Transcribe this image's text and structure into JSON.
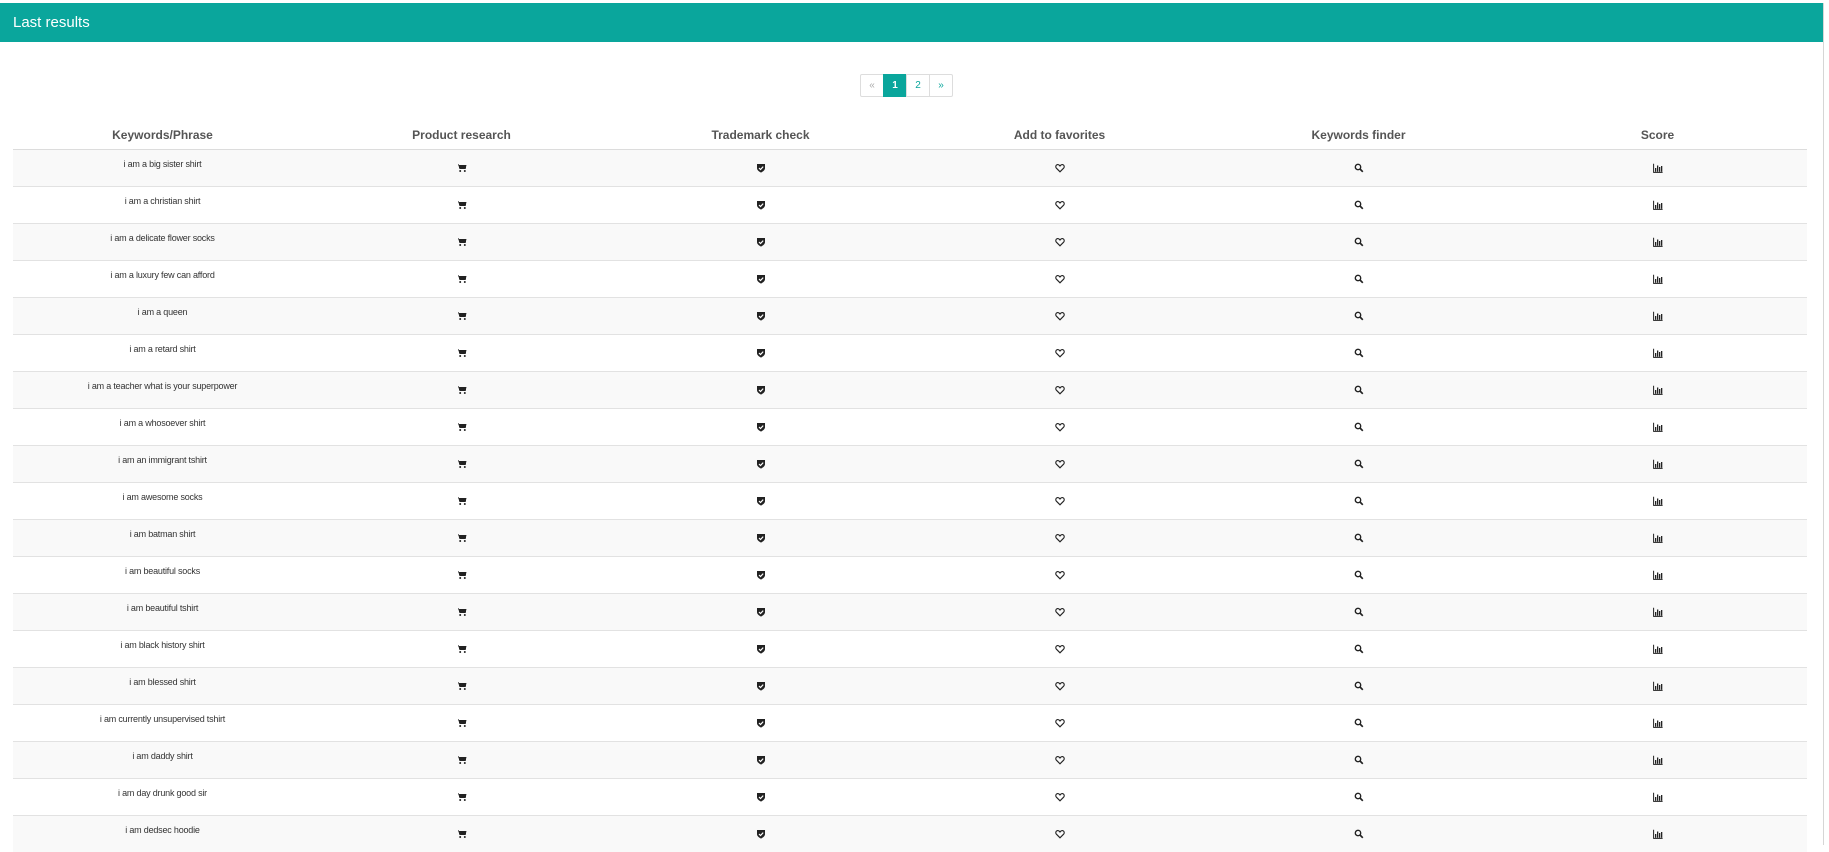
{
  "header": {
    "title": "Last results"
  },
  "pagination": {
    "prev": "«",
    "pages": [
      "1",
      "2"
    ],
    "active": "1",
    "next": "»"
  },
  "table": {
    "columns": [
      "Keywords/Phrase",
      "Product research",
      "Trademark check",
      "Add to favorites",
      "Keywords finder",
      "Score"
    ],
    "row_icons": [
      "cart-icon",
      "shield-check-icon",
      "heart-icon",
      "search-icon",
      "bar-chart-icon"
    ],
    "rows": [
      "i am a big sister shirt",
      "i am a christian shirt",
      "i am a delicate flower socks",
      "i am a luxury few can afford",
      "i am a queen",
      "i am a retard shirt",
      "i am a teacher what is your superpower",
      "i am a whosoever shirt",
      "i am an immigrant tshirt",
      "i am awesome socks",
      "i am batman shirt",
      "i am beautiful socks",
      "i am beautiful tshirt",
      "i am black history shirt",
      "i am blessed shirt",
      "i am currently unsupervised tshirt",
      "i am daddy shirt",
      "i am day drunk good sir",
      "i am dedsec hoodie"
    ]
  },
  "colors": {
    "accent": "#0aa69c",
    "icon": "#222222"
  }
}
